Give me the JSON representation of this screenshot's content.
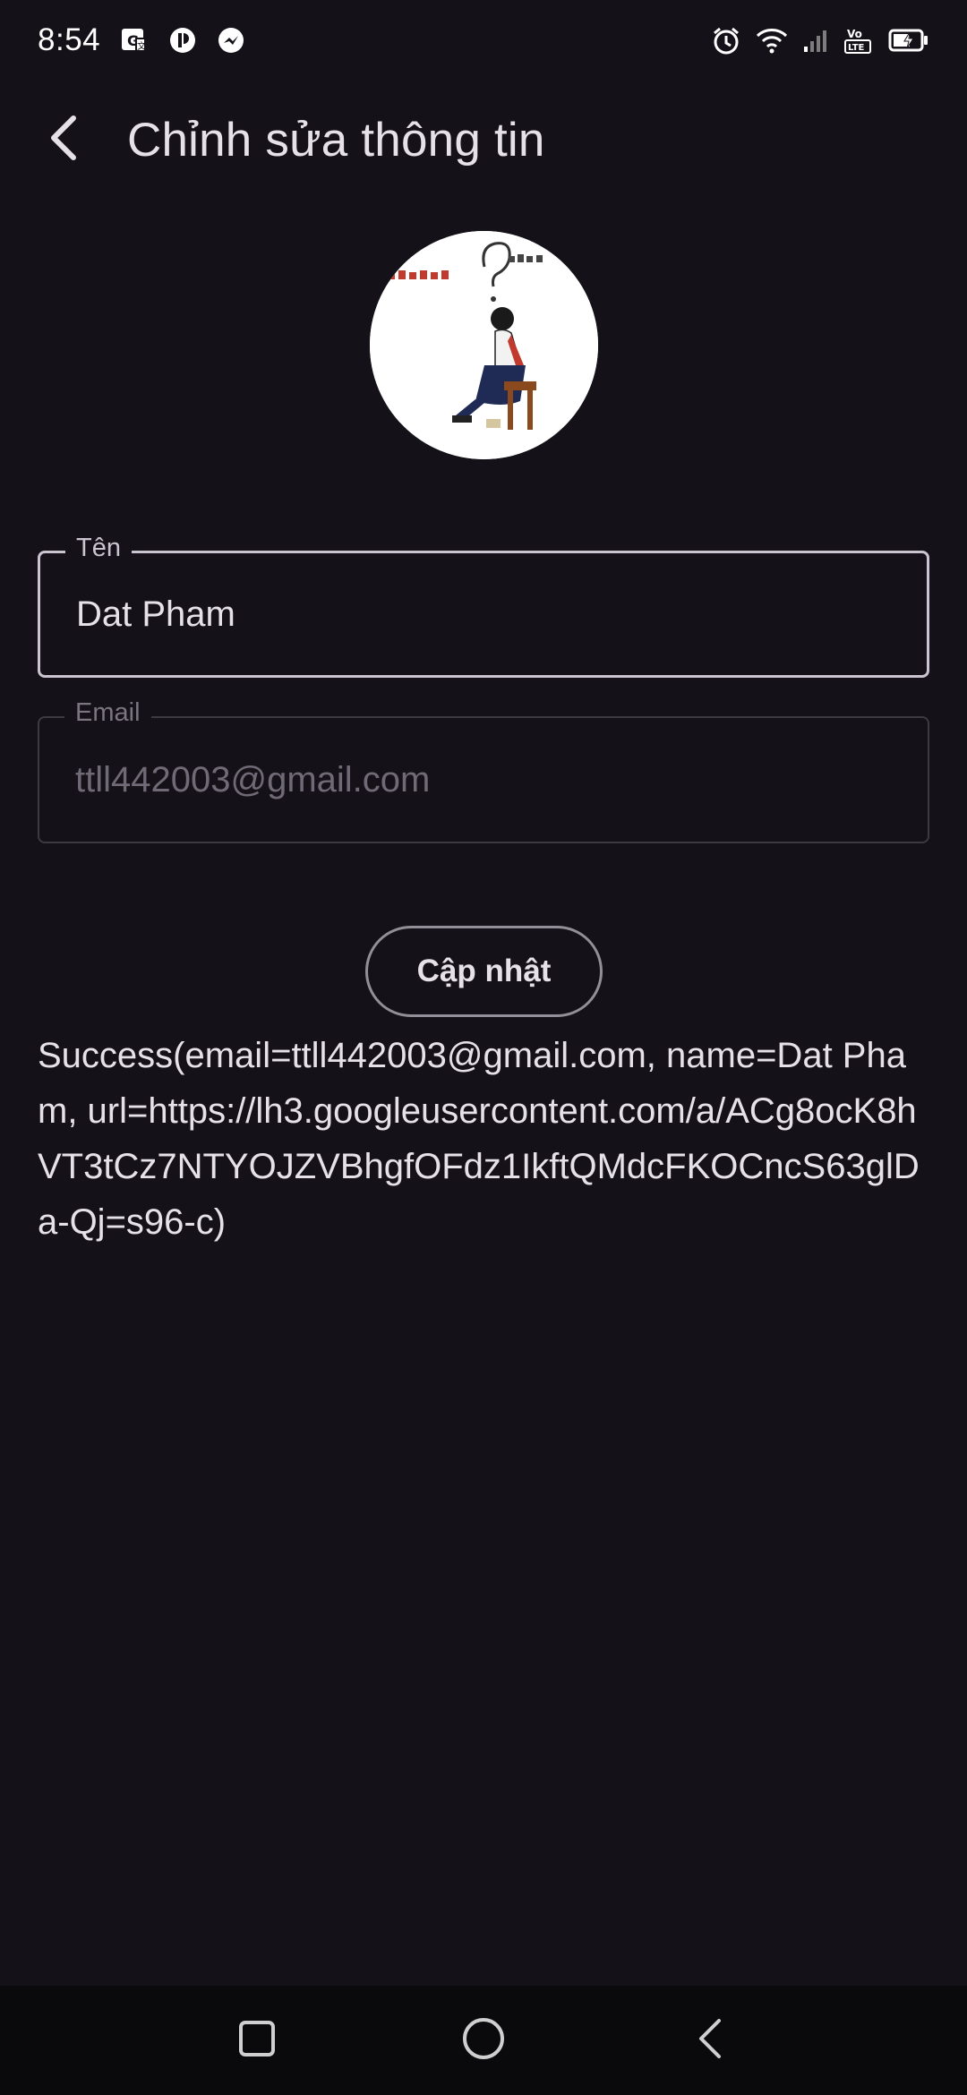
{
  "status_bar": {
    "time": "8:54",
    "left_icons": [
      "translate-icon",
      "podcast-app-icon",
      "messenger-icon"
    ],
    "right_icons": [
      "alarm-icon",
      "wifi-icon",
      "signal-icon",
      "volte-icon",
      "battery-charging-icon"
    ],
    "volte_text": "Vo LTE"
  },
  "header": {
    "back_icon": "chevron-left-icon",
    "title": "Chỉnh sửa thông tin"
  },
  "profile": {
    "avatar_icon": "profile-photo"
  },
  "form": {
    "name_label": "Tên",
    "name_value": "Dat Pham",
    "email_label": "Email",
    "email_value": "ttll442003@gmail.com",
    "update_label": "Cập nhật"
  },
  "result": {
    "text": "Success(email=ttll442003@gmail.com, name=Dat Pham, url=https://lh3.googleusercontent.com/a/ACg8ocK8hVT3tCz7NTYOJZVBhgfOFdz1IkftQMdcFKOCncS63glDa-Qj=s96-c)"
  },
  "nav_bar": {
    "icons": [
      "recents-square-icon",
      "home-circle-icon",
      "back-triangle-icon"
    ]
  },
  "colors": {
    "background": "#141218",
    "on_surface": "#e6e0e9",
    "outline": "#cac4d0",
    "disabled": "#6f6a76",
    "nav_background": "#0a090b"
  }
}
